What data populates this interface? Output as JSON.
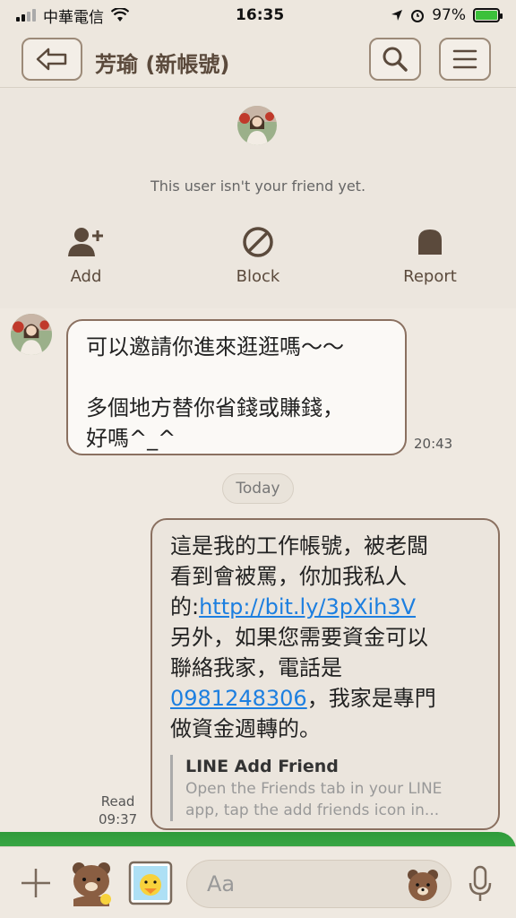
{
  "status_bar": {
    "carrier": "中華電信",
    "time": "16:35",
    "battery": "97%"
  },
  "header": {
    "title": "芳瑜 (新帳號)"
  },
  "profile": {
    "not_friend_text": "This user isn't your friend yet.",
    "actions": [
      {
        "label": "Add"
      },
      {
        "label": "Block"
      },
      {
        "label": "Report"
      }
    ]
  },
  "chat": {
    "incoming": {
      "line1": "可以邀請你進來逛逛嗎～～",
      "line2": "多個地方替你省錢或賺錢，",
      "line3": "好嗎^_^",
      "time": "20:43"
    },
    "date_divider": "Today",
    "outgoing": {
      "line1": "這是我的工作帳號，被老闆",
      "line2": "看到會被罵，你加我私人",
      "line3_prefix": "的:",
      "link": "http://bit.ly/3pXih3V",
      "line4": "另外，如果您需要資金可以",
      "line5": "聯絡我家，電話是",
      "phone": "0981248306",
      "line6_suffix": "，我家是專門",
      "line7": "做資金週轉的。",
      "preview_title": "LINE Add Friend",
      "preview_desc_1": "Open the Friends tab in your LINE",
      "preview_desc_2": "app, tap the add friends icon in...",
      "read": "Read",
      "time": "09:37"
    }
  },
  "input": {
    "placeholder": "Aa"
  },
  "colors": {
    "accent_brown": "#8a7060",
    "link_blue": "#1d7fe0",
    "battery_green": "#3cc13b"
  }
}
